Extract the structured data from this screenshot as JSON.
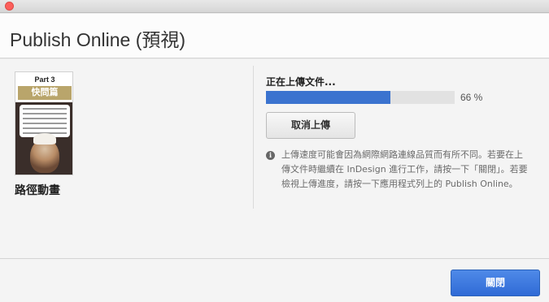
{
  "window": {
    "close_control": "close-icon"
  },
  "header": {
    "title": "Publish Online (預視)"
  },
  "thumbnail": {
    "part_label": "Part 3",
    "section_tag": "快問篇",
    "document_name": "路徑動畫"
  },
  "upload": {
    "status": "正在上傳文件...",
    "progress_fraction": 0.66,
    "progress_text": "66 %",
    "cancel_label": "取消上傳"
  },
  "info": {
    "icon": "info-icon",
    "icon_glyph": "i",
    "message": "上傳速度可能會因為網際網路連線品質而有所不同。若要在上傳文件時繼續在 InDesign 進行工作，請按一下「關閉」。若要檢視上傳進度，請按一下應用程式列上的 Publish Online。"
  },
  "footer": {
    "close_label": "關閉"
  },
  "colors": {
    "accent": "#3b73cf",
    "progress_track": "#e2e2e2",
    "traffic_close": "#fc605c"
  }
}
